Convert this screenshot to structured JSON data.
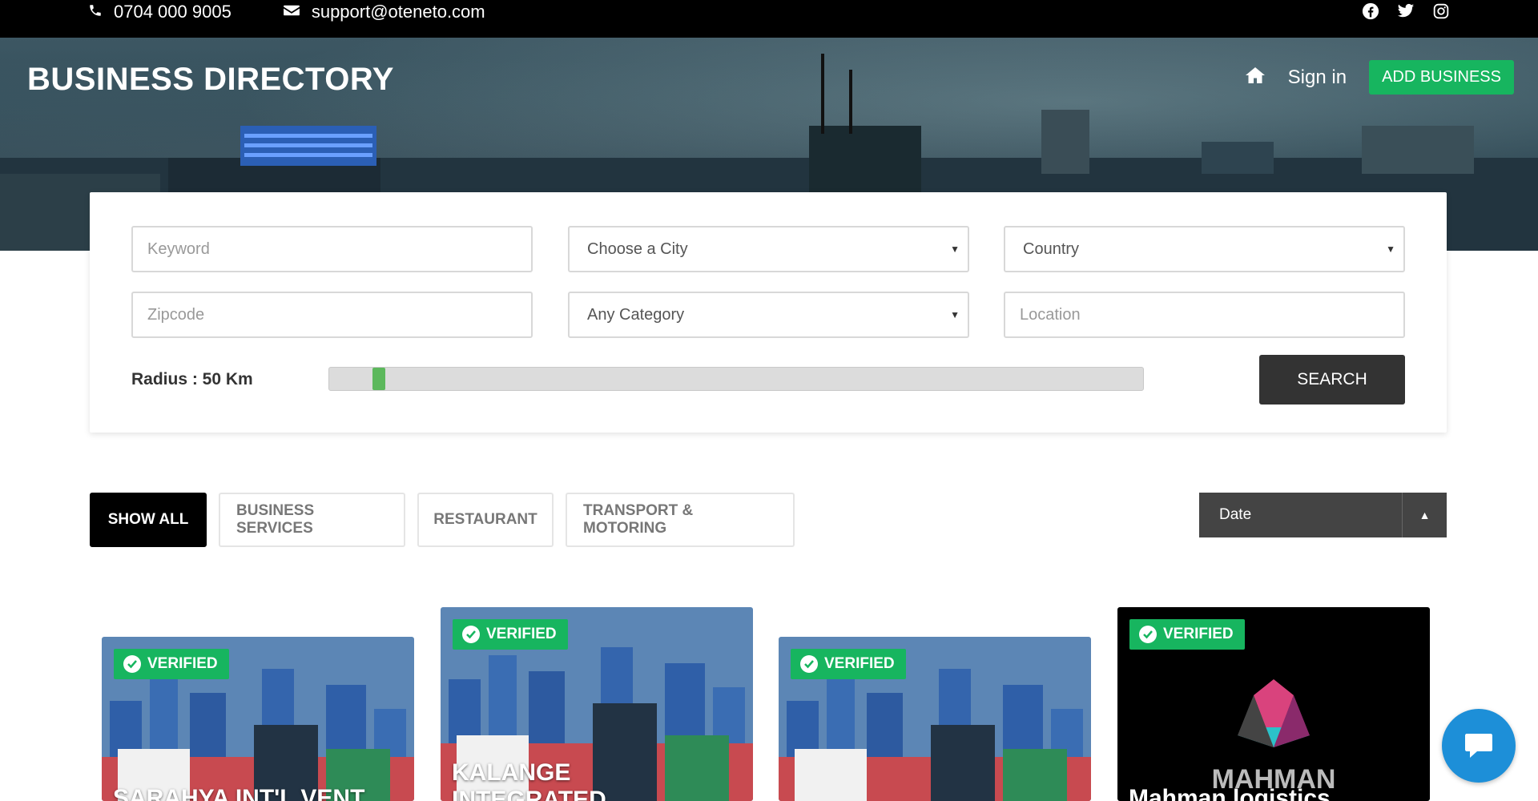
{
  "topbar": {
    "phone": "0704 000 9005",
    "email": "support@oteneto.com",
    "social": [
      "facebook-icon",
      "twitter-icon",
      "instagram-icon"
    ]
  },
  "header": {
    "brand": "BUSINESS DIRECTORY",
    "signin": "Sign in",
    "add_business": "ADD BUSINESS"
  },
  "search": {
    "keyword_placeholder": "Keyword",
    "city_selected": "Choose a City",
    "country_selected": "Country",
    "zipcode_placeholder": "Zipcode",
    "category_selected": "Any Category",
    "location_placeholder": "Location",
    "radius_label": "Radius : 50 Km",
    "search_button": "SEARCH"
  },
  "filters": {
    "items": [
      "SHOW ALL",
      "BUSINESS SERVICES",
      "RESTAURANT",
      "TRANSPORT & MOTORING"
    ],
    "active": "SHOW ALL"
  },
  "sort": {
    "selected": "Date"
  },
  "listings": [
    {
      "badge": "VERIFIED",
      "title": "SARAHYA INT'L VENT"
    },
    {
      "badge": "VERIFIED",
      "title": "KALANGE INTEGRATED VENTURES"
    },
    {
      "badge": "VERIFIED",
      "title": ""
    },
    {
      "badge": "VERIFIED",
      "title": "Mahman logistics",
      "logo_text": "MAHMAN"
    }
  ],
  "colors": {
    "accent_green": "#17b55f",
    "topbar": "#000000",
    "search_button": "#333333",
    "chat": "#1d8fd8"
  }
}
